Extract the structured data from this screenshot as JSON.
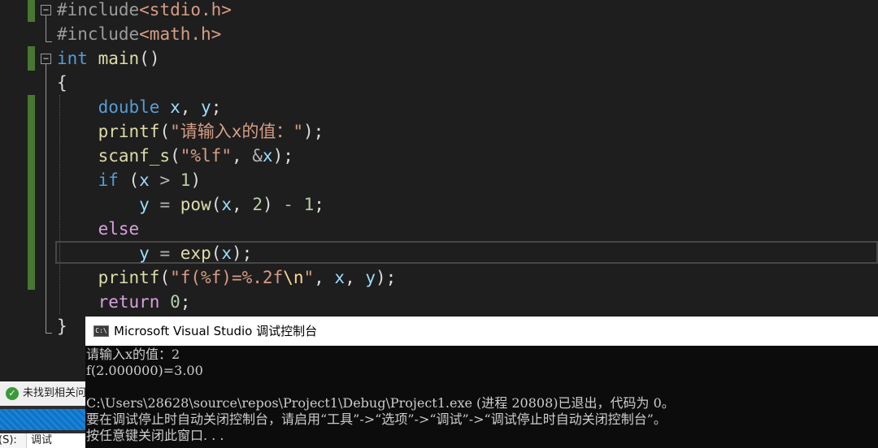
{
  "editor": {
    "lines": [
      [
        {
          "t": "#include",
          "c": "pp"
        },
        {
          "t": "<stdio.h>",
          "c": "inc"
        }
      ],
      [
        {
          "t": "#include",
          "c": "pp"
        },
        {
          "t": "<math.h>",
          "c": "inc"
        }
      ],
      [
        {
          "t": "int",
          "c": "kw"
        },
        {
          "t": " ",
          "c": "pl"
        },
        {
          "t": "main",
          "c": "fn"
        },
        {
          "t": "()",
          "c": "pl"
        }
      ],
      [
        {
          "t": "{",
          "c": "pl"
        }
      ],
      [
        {
          "t": "    ",
          "c": "pl"
        },
        {
          "t": "double",
          "c": "kw"
        },
        {
          "t": " ",
          "c": "pl"
        },
        {
          "t": "x",
          "c": "var"
        },
        {
          "t": ", ",
          "c": "pl"
        },
        {
          "t": "y",
          "c": "var"
        },
        {
          "t": ";",
          "c": "pl"
        }
      ],
      [
        {
          "t": "    ",
          "c": "pl"
        },
        {
          "t": "printf",
          "c": "fn"
        },
        {
          "t": "(",
          "c": "pl"
        },
        {
          "t": "\"请输入x的值：\"",
          "c": "str"
        },
        {
          "t": ");",
          "c": "pl"
        }
      ],
      [
        {
          "t": "    ",
          "c": "pl"
        },
        {
          "t": "scanf_s",
          "c": "fn"
        },
        {
          "t": "(",
          "c": "pl"
        },
        {
          "t": "\"%lf\"",
          "c": "str"
        },
        {
          "t": ", ",
          "c": "pl"
        },
        {
          "t": "&",
          "c": "op"
        },
        {
          "t": "x",
          "c": "var"
        },
        {
          "t": ");",
          "c": "pl"
        }
      ],
      [
        {
          "t": "    ",
          "c": "pl"
        },
        {
          "t": "if",
          "c": "kw"
        },
        {
          "t": " (",
          "c": "pl"
        },
        {
          "t": "x",
          "c": "var"
        },
        {
          "t": " ",
          "c": "pl"
        },
        {
          "t": ">",
          "c": "op"
        },
        {
          "t": " ",
          "c": "pl"
        },
        {
          "t": "1",
          "c": "num"
        },
        {
          "t": ")",
          "c": "pl"
        }
      ],
      [
        {
          "t": "        ",
          "c": "pl"
        },
        {
          "t": "y",
          "c": "var"
        },
        {
          "t": " ",
          "c": "pl"
        },
        {
          "t": "=",
          "c": "op"
        },
        {
          "t": " ",
          "c": "pl"
        },
        {
          "t": "pow",
          "c": "fn"
        },
        {
          "t": "(",
          "c": "pl"
        },
        {
          "t": "x",
          "c": "var"
        },
        {
          "t": ", ",
          "c": "pl"
        },
        {
          "t": "2",
          "c": "num"
        },
        {
          "t": ") ",
          "c": "pl"
        },
        {
          "t": "-",
          "c": "op"
        },
        {
          "t": " ",
          "c": "pl"
        },
        {
          "t": "1",
          "c": "num"
        },
        {
          "t": ";",
          "c": "pl"
        }
      ],
      [
        {
          "t": "    ",
          "c": "pl"
        },
        {
          "t": "else",
          "c": "kw2"
        }
      ],
      [
        {
          "t": "        ",
          "c": "pl"
        },
        {
          "t": "y",
          "c": "var"
        },
        {
          "t": " ",
          "c": "pl"
        },
        {
          "t": "=",
          "c": "op"
        },
        {
          "t": " ",
          "c": "pl"
        },
        {
          "t": "exp",
          "c": "fn"
        },
        {
          "t": "(",
          "c": "pl"
        },
        {
          "t": "x",
          "c": "var"
        },
        {
          "t": ");",
          "c": "pl"
        }
      ],
      [
        {
          "t": "    ",
          "c": "pl"
        },
        {
          "t": "printf",
          "c": "fn"
        },
        {
          "t": "(",
          "c": "pl"
        },
        {
          "t": "\"f(%f)=%.2f",
          "c": "str"
        },
        {
          "t": "\\n",
          "c": "esc"
        },
        {
          "t": "\"",
          "c": "str"
        },
        {
          "t": ", ",
          "c": "pl"
        },
        {
          "t": "x",
          "c": "var"
        },
        {
          "t": ", ",
          "c": "pl"
        },
        {
          "t": "y",
          "c": "var"
        },
        {
          "t": ");",
          "c": "pl"
        }
      ],
      [
        {
          "t": "    ",
          "c": "pl"
        },
        {
          "t": "return",
          "c": "kw2"
        },
        {
          "t": " ",
          "c": "pl"
        },
        {
          "t": "0",
          "c": "num"
        },
        {
          "t": ";",
          "c": "pl"
        }
      ],
      [
        {
          "t": "}",
          "c": "pl"
        }
      ]
    ],
    "fold_collapse_glyph": "−"
  },
  "console": {
    "icon_text": "C:\\",
    "title": "Microsoft Visual Studio 调试控制台",
    "output": [
      "请输入x的值：2",
      "f(2.000000)=3.00",
      "",
      "C:\\Users\\28628\\source\\repos\\Project1\\Debug\\Project1.exe (进程 20808)已退出，代码为 0。",
      "要在调试停止时自动关闭控制台，请启用“工具”->“选项”->“调试”->“调试停止时自动关闭控制台”。",
      "按任意键关闭此窗口. . ."
    ]
  },
  "status": {
    "check_glyph": "✓",
    "message": "未找到相关问题",
    "bottom_label": "(S):",
    "bottom_tab": "调试"
  },
  "colors": {
    "editor_bg": "#1e1e1e",
    "change_bar": "#487733",
    "console_bg": "#0c0c0c",
    "progress": "#1c82d4"
  }
}
